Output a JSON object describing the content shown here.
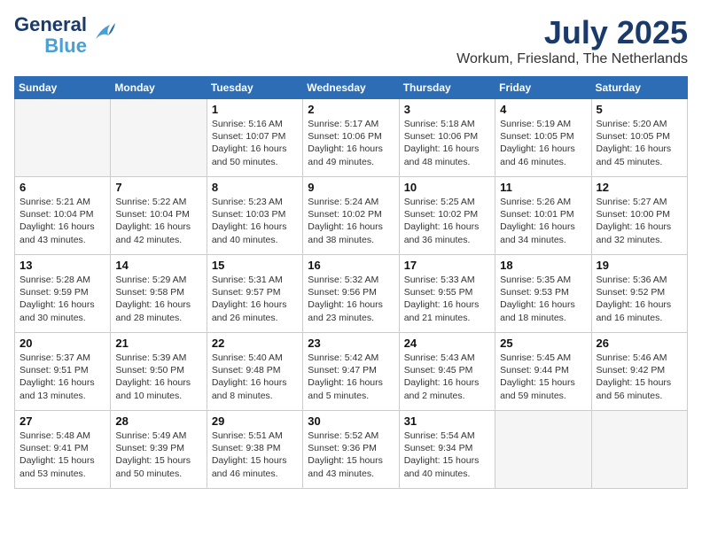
{
  "header": {
    "logo_line1": "General",
    "logo_line2": "Blue",
    "month": "July 2025",
    "location": "Workum, Friesland, The Netherlands"
  },
  "weekdays": [
    "Sunday",
    "Monday",
    "Tuesday",
    "Wednesday",
    "Thursday",
    "Friday",
    "Saturday"
  ],
  "weeks": [
    [
      {
        "day": "",
        "info": ""
      },
      {
        "day": "",
        "info": ""
      },
      {
        "day": "1",
        "info": "Sunrise: 5:16 AM\nSunset: 10:07 PM\nDaylight: 16 hours\nand 50 minutes."
      },
      {
        "day": "2",
        "info": "Sunrise: 5:17 AM\nSunset: 10:06 PM\nDaylight: 16 hours\nand 49 minutes."
      },
      {
        "day": "3",
        "info": "Sunrise: 5:18 AM\nSunset: 10:06 PM\nDaylight: 16 hours\nand 48 minutes."
      },
      {
        "day": "4",
        "info": "Sunrise: 5:19 AM\nSunset: 10:05 PM\nDaylight: 16 hours\nand 46 minutes."
      },
      {
        "day": "5",
        "info": "Sunrise: 5:20 AM\nSunset: 10:05 PM\nDaylight: 16 hours\nand 45 minutes."
      }
    ],
    [
      {
        "day": "6",
        "info": "Sunrise: 5:21 AM\nSunset: 10:04 PM\nDaylight: 16 hours\nand 43 minutes."
      },
      {
        "day": "7",
        "info": "Sunrise: 5:22 AM\nSunset: 10:04 PM\nDaylight: 16 hours\nand 42 minutes."
      },
      {
        "day": "8",
        "info": "Sunrise: 5:23 AM\nSunset: 10:03 PM\nDaylight: 16 hours\nand 40 minutes."
      },
      {
        "day": "9",
        "info": "Sunrise: 5:24 AM\nSunset: 10:02 PM\nDaylight: 16 hours\nand 38 minutes."
      },
      {
        "day": "10",
        "info": "Sunrise: 5:25 AM\nSunset: 10:02 PM\nDaylight: 16 hours\nand 36 minutes."
      },
      {
        "day": "11",
        "info": "Sunrise: 5:26 AM\nSunset: 10:01 PM\nDaylight: 16 hours\nand 34 minutes."
      },
      {
        "day": "12",
        "info": "Sunrise: 5:27 AM\nSunset: 10:00 PM\nDaylight: 16 hours\nand 32 minutes."
      }
    ],
    [
      {
        "day": "13",
        "info": "Sunrise: 5:28 AM\nSunset: 9:59 PM\nDaylight: 16 hours\nand 30 minutes."
      },
      {
        "day": "14",
        "info": "Sunrise: 5:29 AM\nSunset: 9:58 PM\nDaylight: 16 hours\nand 28 minutes."
      },
      {
        "day": "15",
        "info": "Sunrise: 5:31 AM\nSunset: 9:57 PM\nDaylight: 16 hours\nand 26 minutes."
      },
      {
        "day": "16",
        "info": "Sunrise: 5:32 AM\nSunset: 9:56 PM\nDaylight: 16 hours\nand 23 minutes."
      },
      {
        "day": "17",
        "info": "Sunrise: 5:33 AM\nSunset: 9:55 PM\nDaylight: 16 hours\nand 21 minutes."
      },
      {
        "day": "18",
        "info": "Sunrise: 5:35 AM\nSunset: 9:53 PM\nDaylight: 16 hours\nand 18 minutes."
      },
      {
        "day": "19",
        "info": "Sunrise: 5:36 AM\nSunset: 9:52 PM\nDaylight: 16 hours\nand 16 minutes."
      }
    ],
    [
      {
        "day": "20",
        "info": "Sunrise: 5:37 AM\nSunset: 9:51 PM\nDaylight: 16 hours\nand 13 minutes."
      },
      {
        "day": "21",
        "info": "Sunrise: 5:39 AM\nSunset: 9:50 PM\nDaylight: 16 hours\nand 10 minutes."
      },
      {
        "day": "22",
        "info": "Sunrise: 5:40 AM\nSunset: 9:48 PM\nDaylight: 16 hours\nand 8 minutes."
      },
      {
        "day": "23",
        "info": "Sunrise: 5:42 AM\nSunset: 9:47 PM\nDaylight: 16 hours\nand 5 minutes."
      },
      {
        "day": "24",
        "info": "Sunrise: 5:43 AM\nSunset: 9:45 PM\nDaylight: 16 hours\nand 2 minutes."
      },
      {
        "day": "25",
        "info": "Sunrise: 5:45 AM\nSunset: 9:44 PM\nDaylight: 15 hours\nand 59 minutes."
      },
      {
        "day": "26",
        "info": "Sunrise: 5:46 AM\nSunset: 9:42 PM\nDaylight: 15 hours\nand 56 minutes."
      }
    ],
    [
      {
        "day": "27",
        "info": "Sunrise: 5:48 AM\nSunset: 9:41 PM\nDaylight: 15 hours\nand 53 minutes."
      },
      {
        "day": "28",
        "info": "Sunrise: 5:49 AM\nSunset: 9:39 PM\nDaylight: 15 hours\nand 50 minutes."
      },
      {
        "day": "29",
        "info": "Sunrise: 5:51 AM\nSunset: 9:38 PM\nDaylight: 15 hours\nand 46 minutes."
      },
      {
        "day": "30",
        "info": "Sunrise: 5:52 AM\nSunset: 9:36 PM\nDaylight: 15 hours\nand 43 minutes."
      },
      {
        "day": "31",
        "info": "Sunrise: 5:54 AM\nSunset: 9:34 PM\nDaylight: 15 hours\nand 40 minutes."
      },
      {
        "day": "",
        "info": ""
      },
      {
        "day": "",
        "info": ""
      }
    ]
  ]
}
